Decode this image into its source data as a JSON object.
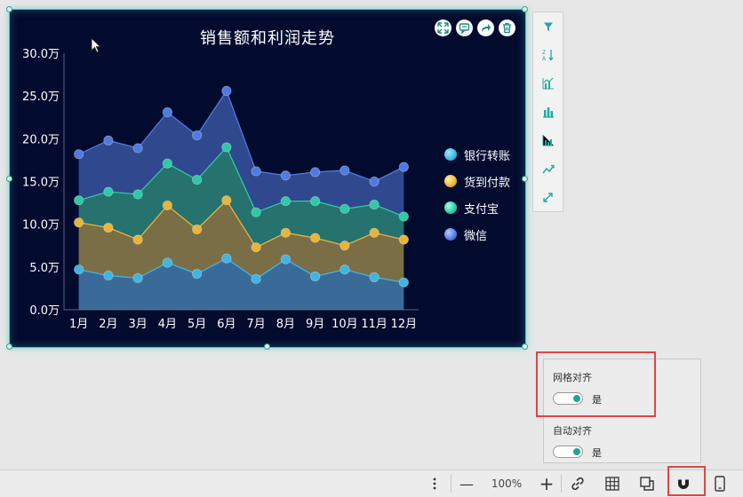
{
  "chart": {
    "title": "销售额和利润走势",
    "tools": [
      "expand-icon",
      "comment-icon",
      "share-icon",
      "delete-icon"
    ]
  },
  "chart_data": {
    "type": "area",
    "stacked": true,
    "title": "销售额和利润走势",
    "categories": [
      "1月",
      "2月",
      "3月",
      "4月",
      "5月",
      "6月",
      "7月",
      "8月",
      "9月",
      "10月",
      "11月",
      "12月"
    ],
    "y_tick_labels": [
      "0.0万",
      "5.0万",
      "10.0万",
      "15.0万",
      "20.0万",
      "25.0万",
      "30.0万"
    ],
    "ylim": [
      0,
      300000
    ],
    "legend_position": "right",
    "grid": false,
    "series": [
      {
        "name": "银行转账",
        "color": "#3fb5e0",
        "values": [
          47000,
          40000,
          37000,
          55000,
          42000,
          60000,
          36000,
          59000,
          39000,
          47000,
          38000,
          32000
        ]
      },
      {
        "name": "货到付款",
        "color": "#e8b43a",
        "values": [
          55000,
          56000,
          45000,
          67000,
          52000,
          68000,
          37000,
          31000,
          45000,
          28000,
          52000,
          50000
        ]
      },
      {
        "name": "支付宝",
        "color": "#2ec9a6",
        "values": [
          26000,
          42000,
          53000,
          49000,
          58000,
          62000,
          41000,
          37000,
          43000,
          43000,
          33000,
          27000
        ]
      },
      {
        "name": "微信",
        "color": "#4f7be0",
        "values": [
          54000,
          60000,
          54000,
          60000,
          52000,
          66000,
          48000,
          30000,
          34000,
          45000,
          27000,
          58000
        ]
      }
    ]
  },
  "side_toolbar": {
    "icons": [
      "filter-icon",
      "sort-icon",
      "combo-chart-icon",
      "bar-chart-icon",
      "grouped-bar-icon",
      "line-chart-icon",
      "resize-icon"
    ]
  },
  "align_panel": {
    "grid_label": "网格对齐",
    "grid_value": "是",
    "auto_label": "自动对齐",
    "auto_value": "是"
  },
  "bottom_bar": {
    "zoom": "100%",
    "zoom_out": "—",
    "zoom_in": "+"
  }
}
